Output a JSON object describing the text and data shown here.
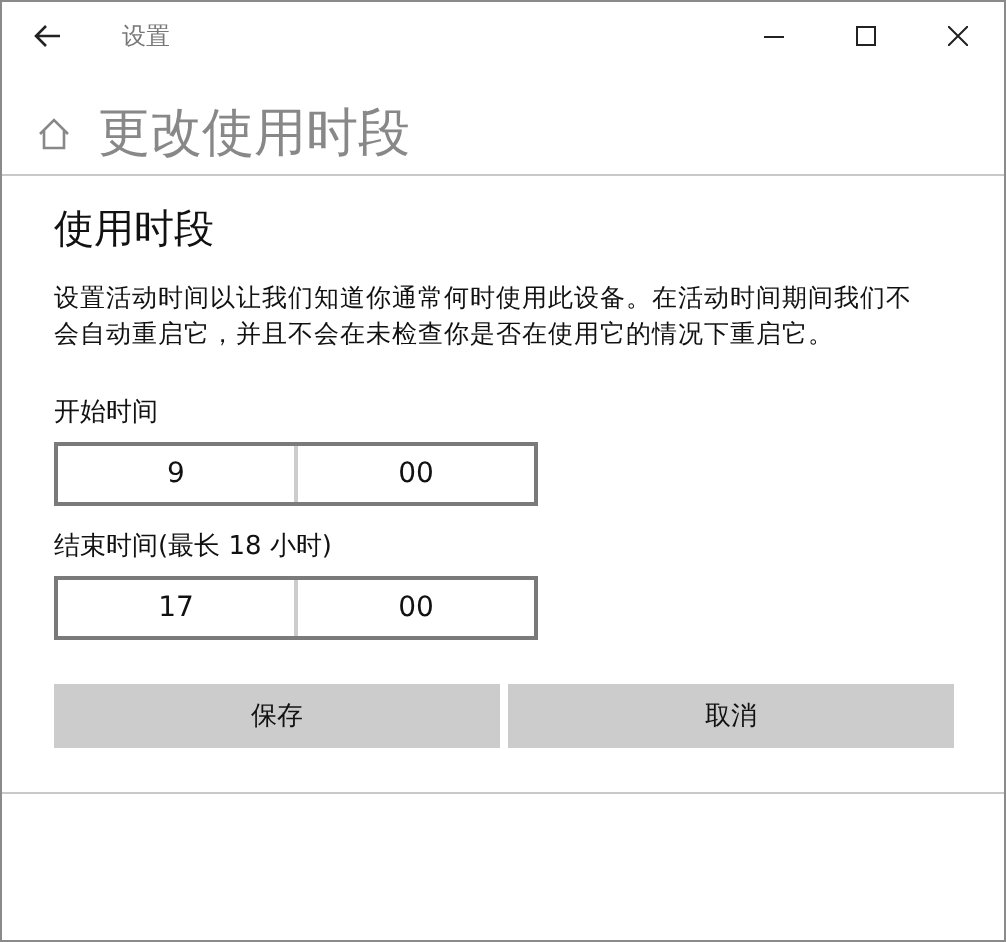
{
  "window": {
    "title": "设置"
  },
  "page": {
    "heading": "更改使用时段"
  },
  "dialog": {
    "title": "使用时段",
    "description": "设置活动时间以让我们知道你通常何时使用此设备。在活动时间期间我们不会自动重启它，并且不会在未检查你是否在使用它的情况下重启它。",
    "pickers": [
      {
        "label": "开始时间",
        "hour": "9",
        "minute": "00"
      },
      {
        "label": "结束时间(最长 18 小时)",
        "hour": "17",
        "minute": "00"
      }
    ],
    "buttons": [
      "保存",
      "取消"
    ]
  }
}
